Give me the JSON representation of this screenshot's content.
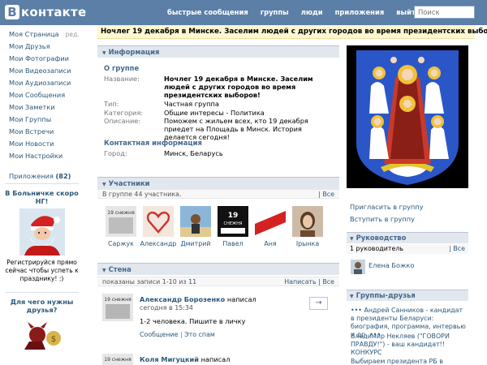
{
  "header": {
    "logo_letter": "B",
    "logo_text": "контакте",
    "nav": [
      "быстрые сообщения",
      "группы",
      "люди",
      "приложения",
      "выйти"
    ],
    "search_placeholder": "Поиск"
  },
  "leftmenu": {
    "items": [
      "Моя Страница",
      "Мои Друзья",
      "Мои Фотографии",
      "Мои Видеозаписи",
      "Мои Аудиозаписи",
      "Мои Сообщения",
      "Мои Заметки",
      "Мои Группы",
      "Мои Встречи",
      "Мои Новости",
      "Мои Настройки"
    ],
    "edit": "ред.",
    "apps_label": "Приложения",
    "apps_count": "(82)"
  },
  "ads": [
    {
      "title": "В Больничке скоро НГ!",
      "text": "Регистрируйся прямо сейчас чтобы успеть к празднику! :)"
    },
    {
      "title": "Для чего нужны друзья?"
    }
  ],
  "group": {
    "title": "Ночлег 19 декабря в Минске. Заселим людей с других городов во время президентских выборов!"
  },
  "info": {
    "header": "Информация",
    "about_title": "О группе",
    "name_label": "Название:",
    "name_value": "Ночлег 19 декабря в Минске. Заселим людей с других городов во время президентских выборов!",
    "type_label": "Тип:",
    "type_value": "Частная группа",
    "category_label": "Категория:",
    "category_value": "Общие интересы - Политика",
    "desc_label": "Описание:",
    "desc_value": "Поможем с жильем всех, кто 19 декабря приедет на Площадь в Минск. История делается сегодня!",
    "contact_title": "Контактная информация",
    "city_label": "Город:",
    "city_value": "Минск, Беларусь"
  },
  "members": {
    "header": "Участники",
    "count_text": "В группе 44 участника.",
    "all_link": "Все",
    "people": [
      "Саржук",
      "Алексaндр",
      "Дмитрий",
      "Павел",
      "Аня",
      "Ірынка"
    ]
  },
  "wall": {
    "header": "Стена",
    "shown_text": "показаны записи 1-10 из",
    "total": "11",
    "write_link": "Написать",
    "separator": "|",
    "all_link": "Все",
    "posts": [
      {
        "author": "Александр Борозенко",
        "action": "написал",
        "date": "сегодня в 15:34",
        "text": "1-2 человека. Пишите в личку",
        "links": [
          "Сообщение",
          "Это спам"
        ],
        "reply": "→"
      },
      {
        "author": "Коля Мигуцкий",
        "action": "написал"
      }
    ]
  },
  "right": {
    "invite": "Пригласить в группу",
    "join": "Вступить в группу",
    "leaders_header": "Руководство",
    "leaders_count": "1 руководитель",
    "leaders_all": "Все",
    "leader_name": "Елена Божко",
    "friends_header": "Группы-друзья",
    "friends_text": [
      "••• Андрей Санников - кандидат в президенты Беларуси: биография, программа, интервью и др. •••",
      "Владимир Некляев (\"ГОВОРИ ПРАВДУ!\") - ваш кандидат!! КОНКУРС",
      "Выбираем президента РБ в"
    ]
  }
}
